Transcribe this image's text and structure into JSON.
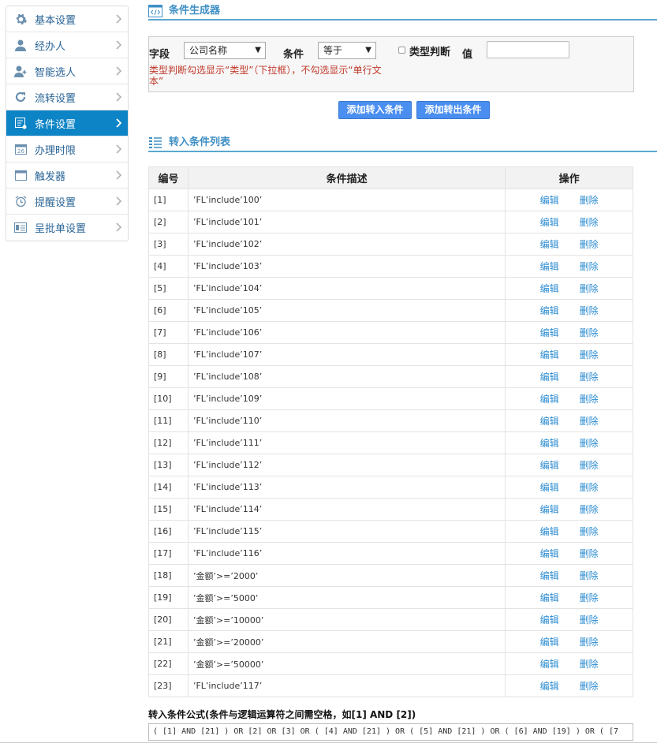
{
  "sidebar": {
    "items": [
      {
        "label": "基本设置",
        "icon": "gear-icon",
        "active": false
      },
      {
        "label": "经办人",
        "icon": "user-icon",
        "active": false
      },
      {
        "label": "智能选人",
        "icon": "user-add-icon",
        "active": false
      },
      {
        "label": "流转设置",
        "icon": "refresh-icon",
        "active": false
      },
      {
        "label": "条件设置",
        "icon": "condition-icon",
        "active": true
      },
      {
        "label": "办理时限",
        "icon": "calendar-icon",
        "active": false
      },
      {
        "label": "触发器",
        "icon": "window-icon",
        "active": false
      },
      {
        "label": "提醒设置",
        "icon": "alarm-clock-icon",
        "active": false
      },
      {
        "label": "呈批单设置",
        "icon": "form-icon",
        "active": false
      }
    ]
  },
  "builder": {
    "title": "条件生成器",
    "field_label": "字段",
    "field_value": "公司名称",
    "condition_label": "条件",
    "condition_value": "等于",
    "type_check_label": "类型判断",
    "value_label": "值",
    "value_input": "",
    "hint": "类型判断勾选显示“类型”（下拉框），不勾选显示“单行文本”",
    "add_in_button": "添加转入条件",
    "add_out_button": "添加转出条件"
  },
  "list": {
    "title": "转入条件列表",
    "headers": {
      "id": "编号",
      "desc": "条件描述",
      "ops": "操作"
    },
    "edit_label": "编辑",
    "delete_label": "删除",
    "rows": [
      {
        "id": "[1]",
        "desc": "’FL’include’100’"
      },
      {
        "id": "[2]",
        "desc": "’FL’include’101’"
      },
      {
        "id": "[3]",
        "desc": "’FL’include’102’"
      },
      {
        "id": "[4]",
        "desc": "’FL’include’103’"
      },
      {
        "id": "[5]",
        "desc": "’FL’include’104’"
      },
      {
        "id": "[6]",
        "desc": "’FL’include’105’"
      },
      {
        "id": "[7]",
        "desc": "’FL’include’106’"
      },
      {
        "id": "[8]",
        "desc": "’FL’include’107’"
      },
      {
        "id": "[9]",
        "desc": "’FL’include’108’"
      },
      {
        "id": "[10]",
        "desc": "’FL’include’109’"
      },
      {
        "id": "[11]",
        "desc": "’FL’include’110’"
      },
      {
        "id": "[12]",
        "desc": "’FL’include’111’"
      },
      {
        "id": "[13]",
        "desc": "’FL’include’112’"
      },
      {
        "id": "[14]",
        "desc": "’FL’include’113’"
      },
      {
        "id": "[15]",
        "desc": "’FL’include’114’"
      },
      {
        "id": "[16]",
        "desc": "’FL’include’115’"
      },
      {
        "id": "[17]",
        "desc": "’FL’include’116’"
      },
      {
        "id": "[18]",
        "desc": "’金额’>=’2000’"
      },
      {
        "id": "[19]",
        "desc": "’金额’>=’5000’"
      },
      {
        "id": "[20]",
        "desc": "’金额’>=’10000’"
      },
      {
        "id": "[21]",
        "desc": "’金额’>=’20000’"
      },
      {
        "id": "[22]",
        "desc": "’金额’>=’50000’"
      },
      {
        "id": "[23]",
        "desc": "’FL’include’117’"
      }
    ]
  },
  "formula": {
    "title": "转入条件公式(条件与逻辑运算符之间需空格，如[1] AND [2])",
    "value": "( [1] AND [21] ) OR  [2]  OR [3] OR  ( [4] AND [21] ) OR ( [5] AND [21] ) OR ( [6] AND [19] ) OR ( [7"
  },
  "colors": {
    "accent": "#0d84c6",
    "button": "#4a8ef0",
    "hint": "#c0392b",
    "link": "#2a8bd0"
  }
}
